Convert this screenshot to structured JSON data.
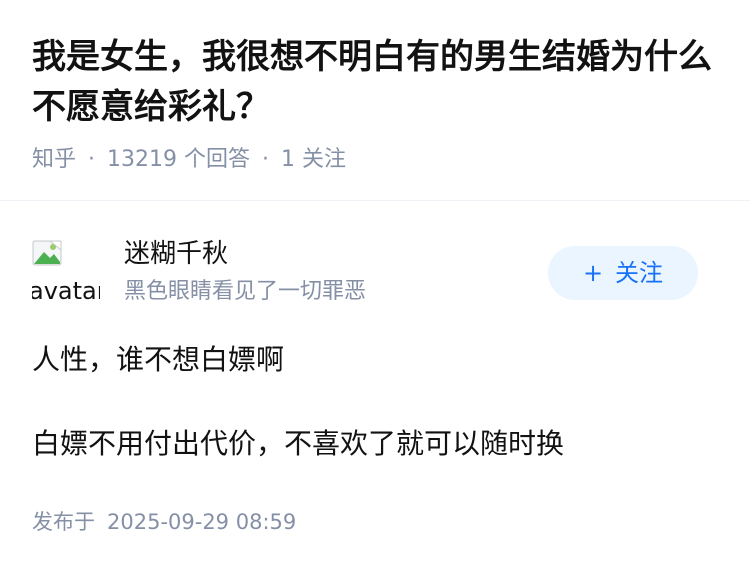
{
  "question": {
    "title": "我是女生，我很想不明白有的男生结婚为什么不愿意给彩礼？",
    "source": "知乎",
    "answer_count": "13219",
    "answer_count_label": "个回答",
    "follower_count": "1",
    "follower_label": "关注"
  },
  "author": {
    "avatar_alt": "avatar",
    "name": "迷糊千秋",
    "bio": "黑色眼睛看见了一切罪恶",
    "follow_plus": "+",
    "follow_label": "关注"
  },
  "answer": {
    "paragraphs": [
      "人性，谁不想白嫖啊",
      "白嫖不用付出代价，不喜欢了就可以随时换"
    ],
    "publish_prefix": "发布于",
    "publish_time": "2025-09-29 08:59"
  },
  "colors": {
    "title": "#121212",
    "meta": "#8590a6",
    "follow_bg": "#ebf5ff",
    "follow_text": "#1772f6"
  }
}
